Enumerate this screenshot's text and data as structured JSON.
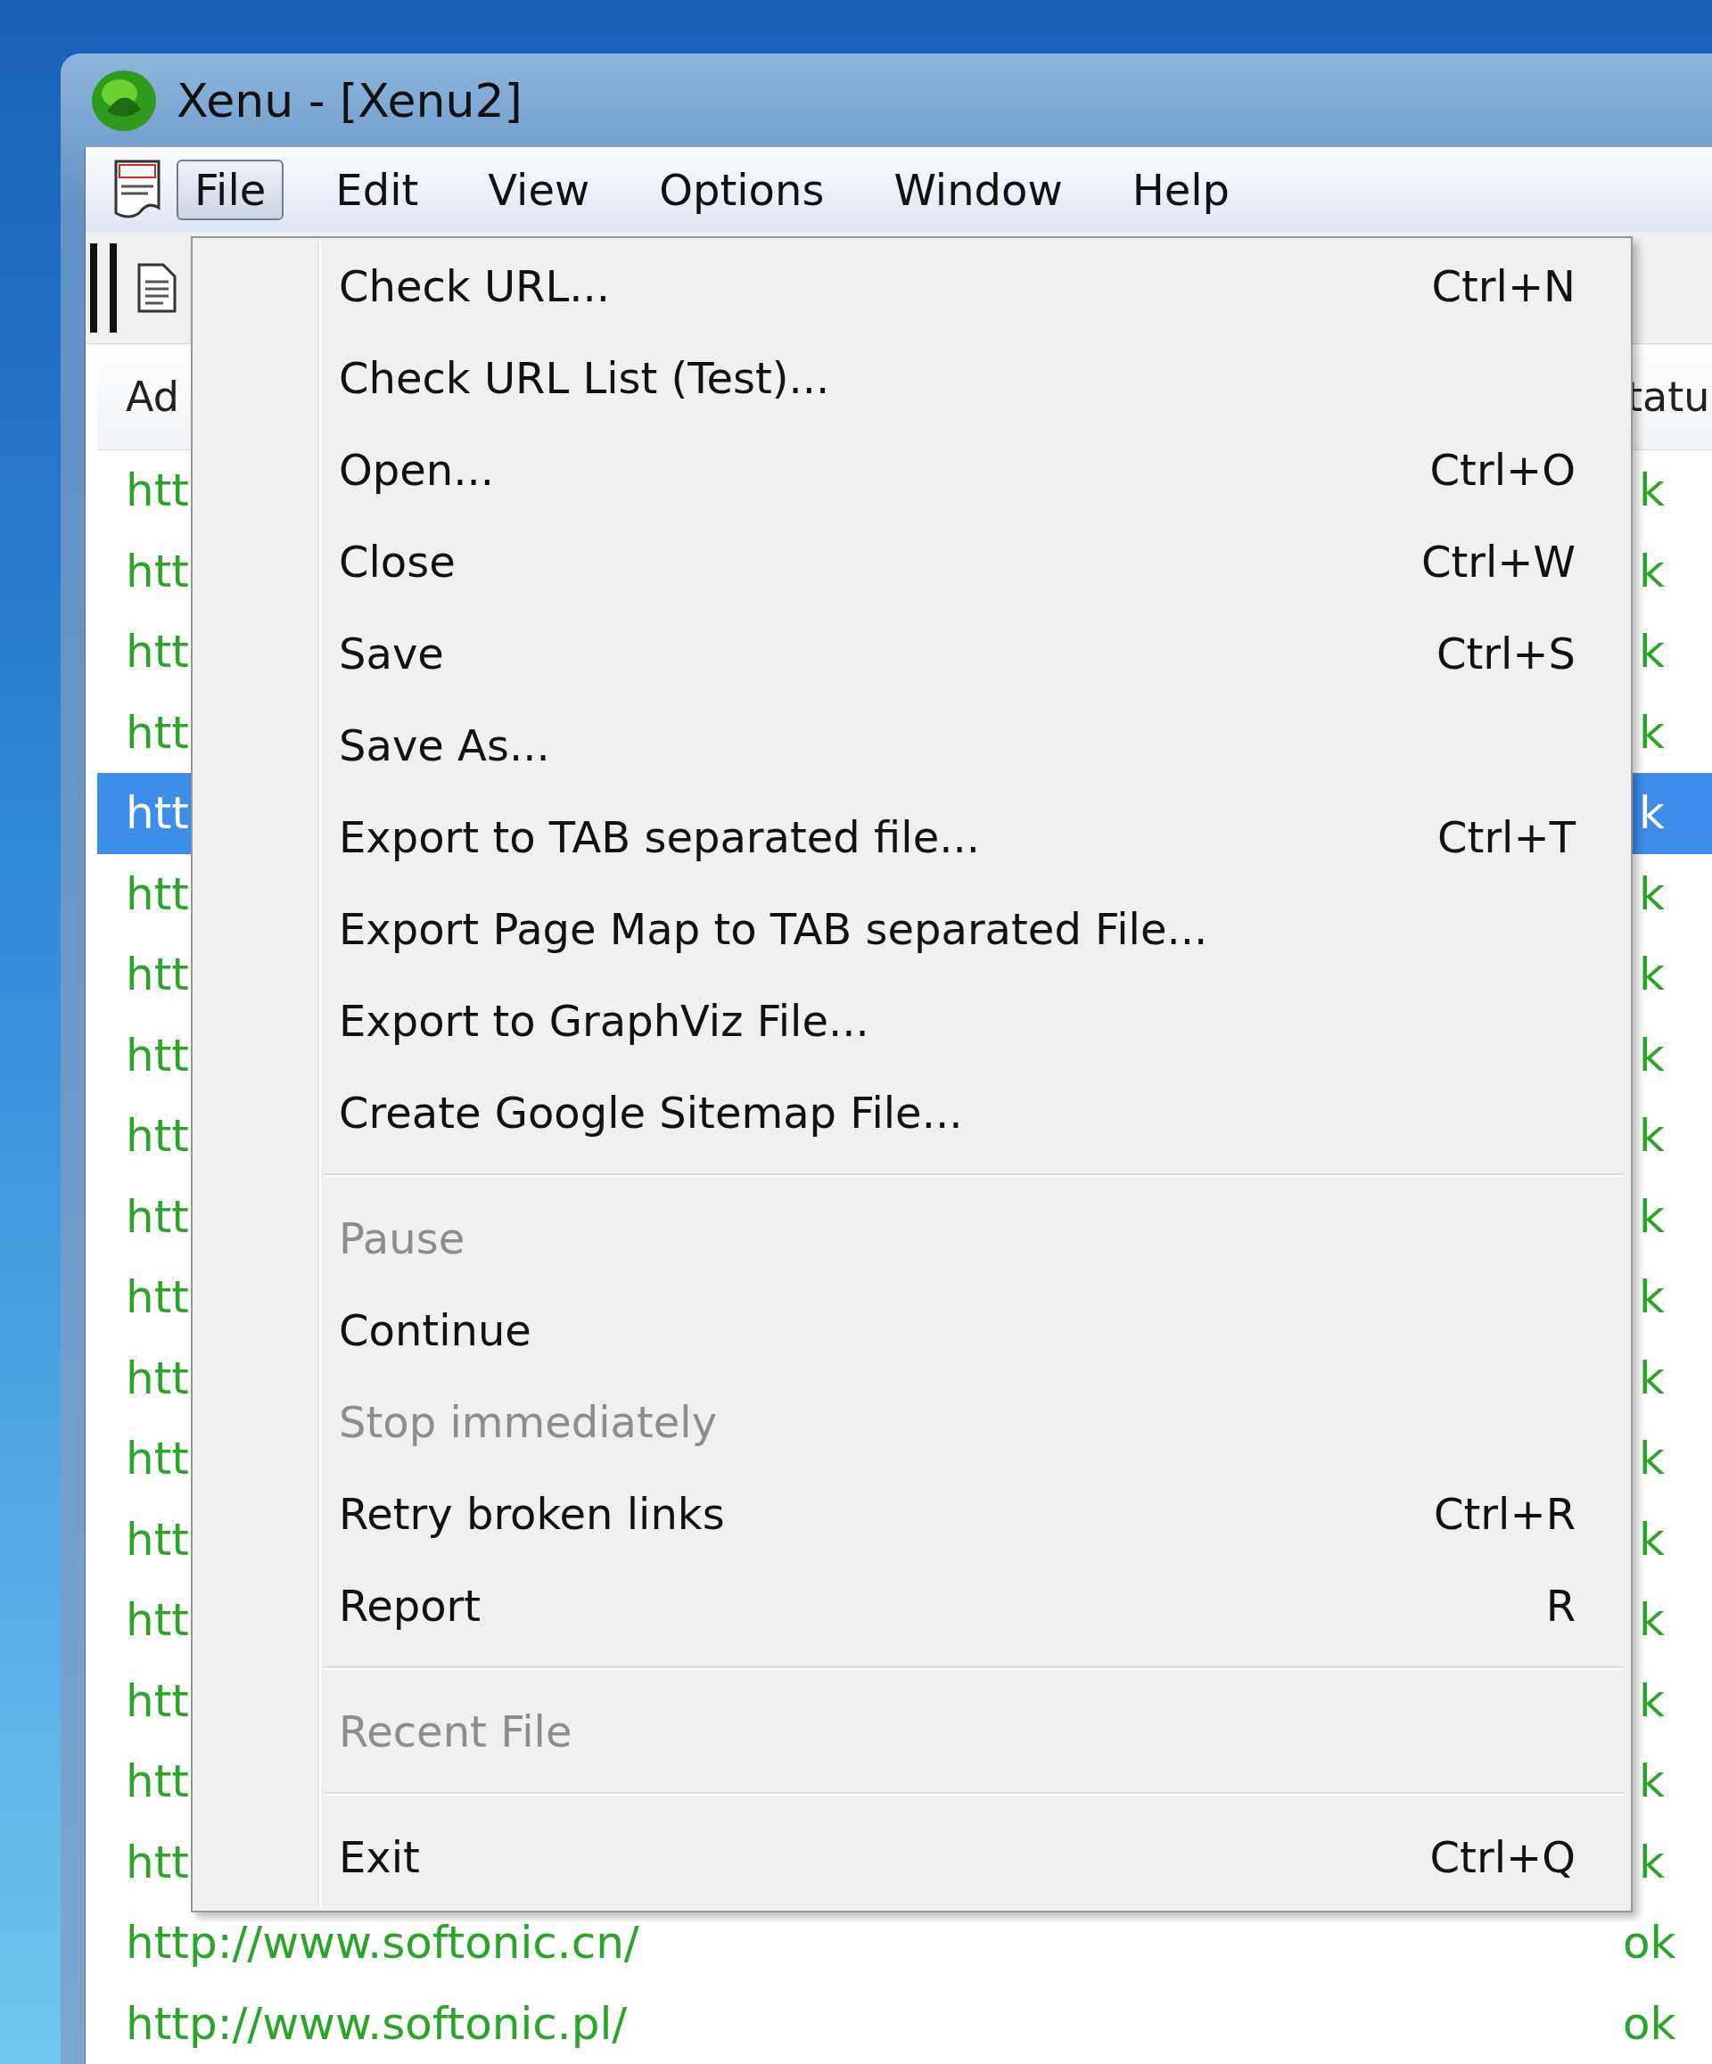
{
  "window": {
    "title": "Xenu - [Xenu2]"
  },
  "menu_bar": [
    {
      "label": "File",
      "selected": true
    },
    {
      "label": "Edit",
      "selected": false
    },
    {
      "label": "View",
      "selected": false
    },
    {
      "label": "Options",
      "selected": false
    },
    {
      "label": "Window",
      "selected": false
    },
    {
      "label": "Help",
      "selected": false
    }
  ],
  "table": {
    "columns": [
      "Ad",
      "tatu"
    ],
    "rows": [
      {
        "address": "htt",
        "status": "k",
        "selected": false
      },
      {
        "address": "htt",
        "status": "k",
        "selected": false
      },
      {
        "address": "htt",
        "status": "k",
        "selected": false
      },
      {
        "address": "htt",
        "status": "k",
        "selected": false
      },
      {
        "address": "htt",
        "status": "k",
        "selected": true
      },
      {
        "address": "htt",
        "status": "k",
        "selected": false
      },
      {
        "address": "htt",
        "status": "k",
        "selected": false
      },
      {
        "address": "htt",
        "status": "k",
        "selected": false
      },
      {
        "address": "htt",
        "status": "k",
        "selected": false
      },
      {
        "address": "htt",
        "status": "k",
        "selected": false
      },
      {
        "address": "htt",
        "status": "k",
        "selected": false
      },
      {
        "address": "htt",
        "status": "k",
        "selected": false
      },
      {
        "address": "htt",
        "status": "k",
        "selected": false
      },
      {
        "address": "htt",
        "status": "k",
        "selected": false
      },
      {
        "address": "htt",
        "status": "k",
        "selected": false
      },
      {
        "address": "htt",
        "status": "k",
        "selected": false
      },
      {
        "address": "htt",
        "status": "k",
        "selected": false
      },
      {
        "address": "htt",
        "status": "k",
        "selected": false
      },
      {
        "address": "http://www.softonic.cn/",
        "status": "ok",
        "selected": false
      },
      {
        "address": "http://www.softonic.pl/",
        "status": "ok",
        "selected": false
      }
    ]
  },
  "file_menu": {
    "items": [
      {
        "kind": "item",
        "label": "Check URL...",
        "shortcut": "Ctrl+N",
        "disabled": false
      },
      {
        "kind": "item",
        "label": "Check URL List (Test)...",
        "disabled": false
      },
      {
        "kind": "item",
        "label": "Open...",
        "shortcut": "Ctrl+O",
        "disabled": false
      },
      {
        "kind": "item",
        "label": "Close",
        "shortcut": "Ctrl+W",
        "disabled": false
      },
      {
        "kind": "item",
        "label": "Save",
        "shortcut": "Ctrl+S",
        "disabled": false
      },
      {
        "kind": "item",
        "label": "Save As...",
        "disabled": false
      },
      {
        "kind": "item",
        "label": "Export to TAB separated file...",
        "shortcut": "Ctrl+T",
        "disabled": false
      },
      {
        "kind": "item",
        "label": "Export Page Map to TAB separated File...",
        "disabled": false
      },
      {
        "kind": "item",
        "label": "Export to GraphViz File...",
        "disabled": false
      },
      {
        "kind": "item",
        "label": "Create Google Sitemap File...",
        "disabled": false
      },
      {
        "kind": "separator"
      },
      {
        "kind": "item",
        "label": "Pause",
        "disabled": true
      },
      {
        "kind": "item",
        "label": "Continue",
        "disabled": false
      },
      {
        "kind": "item",
        "label": "Stop immediately",
        "disabled": true
      },
      {
        "kind": "item",
        "label": "Retry broken links",
        "shortcut": "Ctrl+R",
        "disabled": false
      },
      {
        "kind": "item",
        "label": "Report",
        "shortcut": "R",
        "disabled": false
      },
      {
        "kind": "separator"
      },
      {
        "kind": "item",
        "label": "Recent File",
        "disabled": true
      },
      {
        "kind": "separator"
      },
      {
        "kind": "item",
        "label": "Exit",
        "shortcut": "Ctrl+Q",
        "disabled": false
      }
    ]
  }
}
